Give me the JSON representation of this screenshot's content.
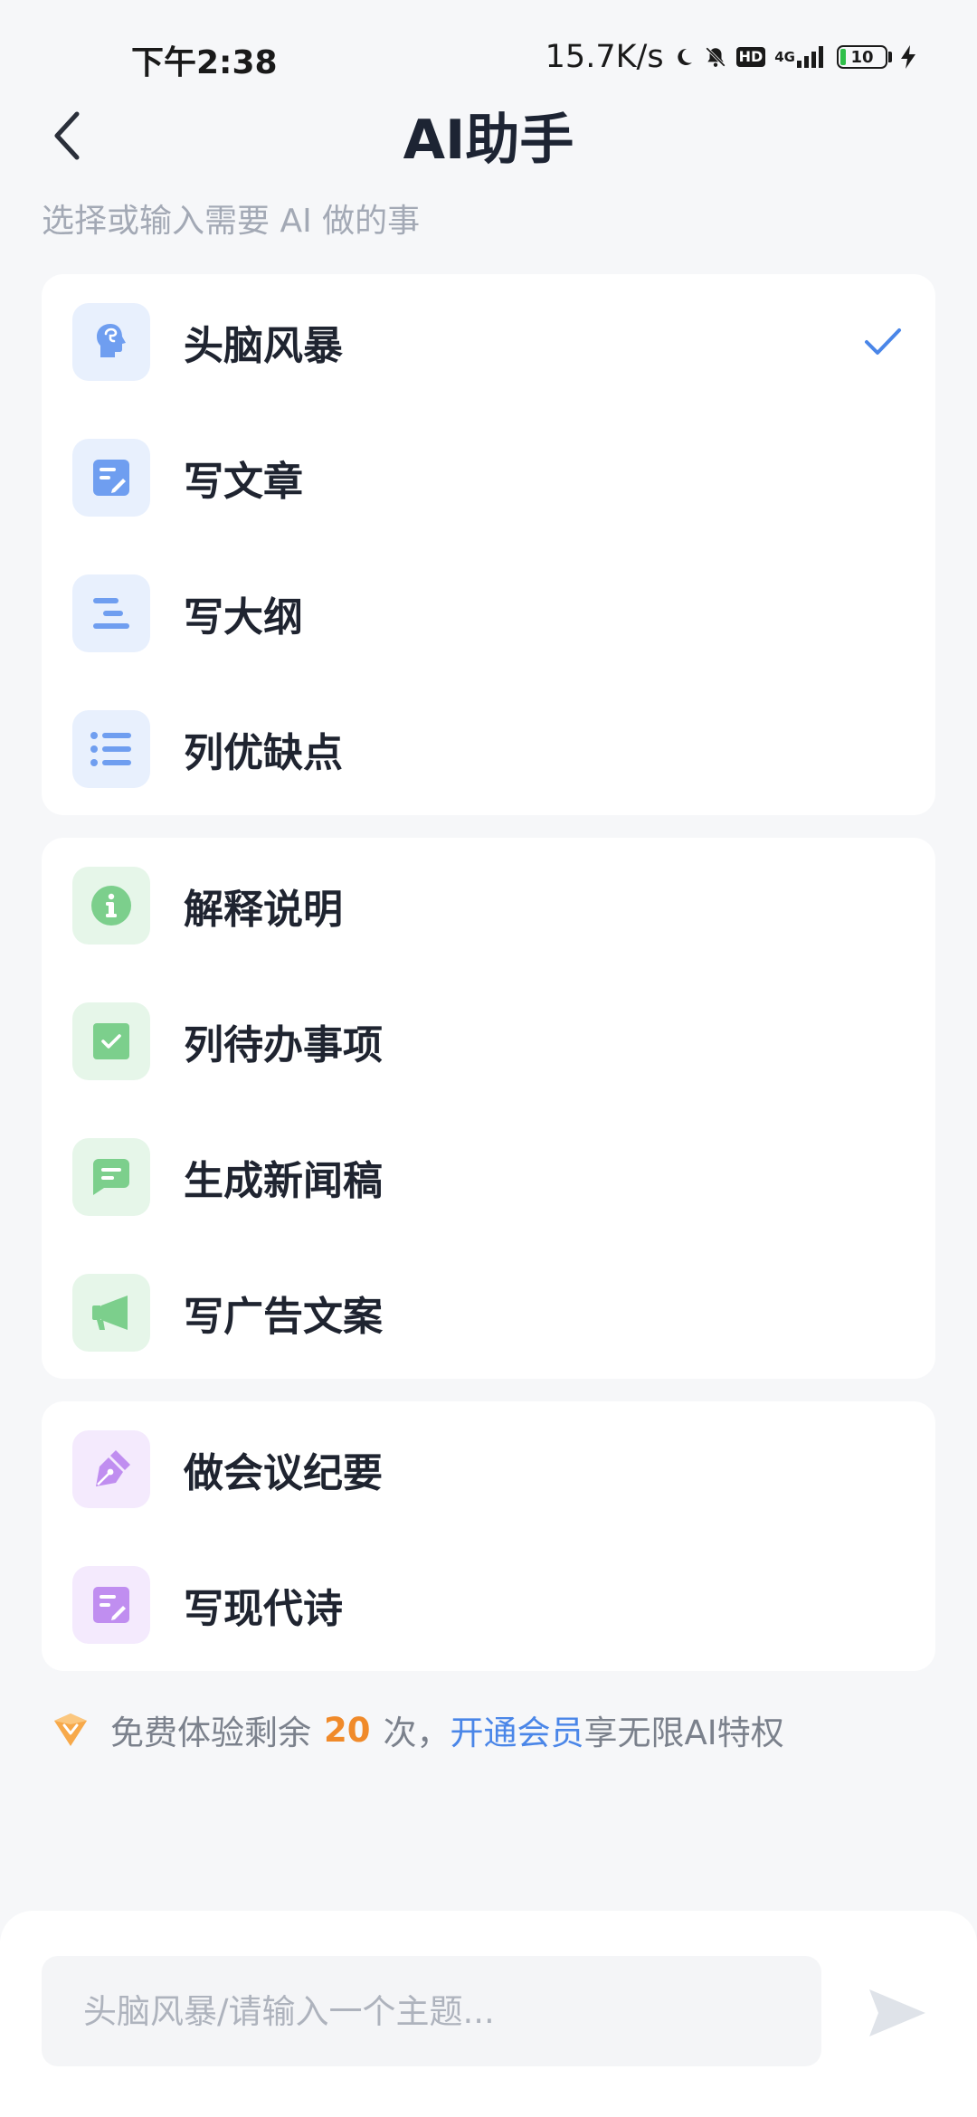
{
  "status_bar": {
    "time": "下午2:38",
    "net_speed": "15.7K/s",
    "hd_label": "HD",
    "network_label": "4G",
    "battery_level": "10"
  },
  "header": {
    "title": "AI助手"
  },
  "subtitle": "选择或输入需要 AI 做的事",
  "groups": [
    {
      "items": [
        {
          "label": "头脑风暴",
          "icon": "brain-head-icon",
          "selected": true
        },
        {
          "label": "写文章",
          "icon": "article-edit-icon",
          "selected": false
        },
        {
          "label": "写大纲",
          "icon": "outline-lines-icon",
          "selected": false
        },
        {
          "label": "列优缺点",
          "icon": "bullet-list-icon",
          "selected": false
        }
      ]
    },
    {
      "items": [
        {
          "label": "解释说明",
          "icon": "info-icon",
          "selected": false
        },
        {
          "label": "列待办事项",
          "icon": "checkbox-icon",
          "selected": false
        },
        {
          "label": "生成新闻稿",
          "icon": "message-doc-icon",
          "selected": false
        },
        {
          "label": "写广告文案",
          "icon": "megaphone-icon",
          "selected": false
        }
      ]
    },
    {
      "items": [
        {
          "label": "做会议纪要",
          "icon": "pen-nib-icon",
          "selected": false
        },
        {
          "label": "写现代诗",
          "icon": "poem-doc-icon",
          "selected": false
        }
      ]
    }
  ],
  "trial": {
    "prefix": "免费体验剩余",
    "count": "20",
    "suffix": "次，",
    "link": "开通会员",
    "tail": "享无限AI特权"
  },
  "input": {
    "placeholder": "头脑风暴/请输入一个主题..."
  },
  "colors": {
    "accent_blue": "#4a86e8",
    "accent_orange": "#f08a2a",
    "icon_blue": "#6f9ef0",
    "icon_green": "#7ccf8c",
    "icon_purple": "#c08ef0"
  }
}
